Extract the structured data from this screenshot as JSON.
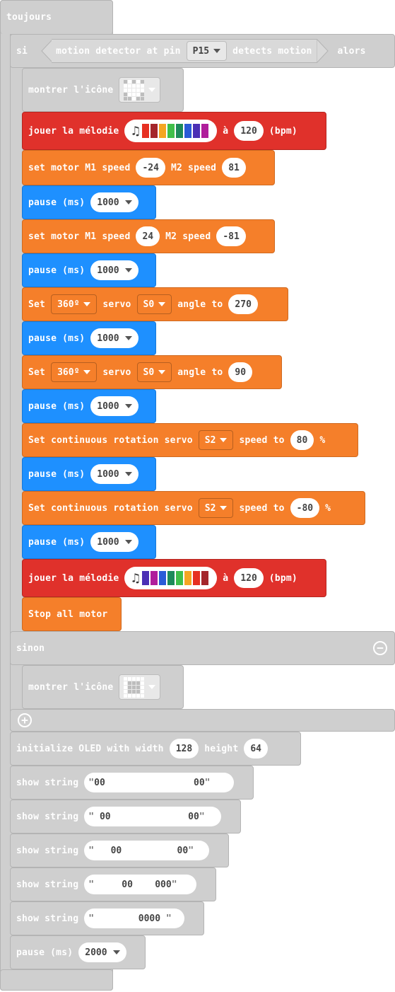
{
  "forever": {
    "label": "toujours"
  },
  "if_block": {
    "if_label": "si",
    "then_label": "alors",
    "condition": {
      "label_prefix": "motion detector at pin",
      "pin": "P15",
      "label_suffix": "detects motion"
    },
    "else_label": "sinon"
  },
  "icons": {
    "minus": "−",
    "plus": "+",
    "note": "♫"
  },
  "colors": {
    "gray": "#cfcfcf",
    "music_red": "#e0312b",
    "motor_orange": "#f57f2a",
    "pause_blue": "#1e90ff"
  },
  "melody_colors": [
    "#e63022",
    "#a4262c",
    "#f5a623",
    "#40bf4a",
    "#1d8a5a",
    "#2a5bd7",
    "#4b2fb5",
    "#b01e9b"
  ],
  "melody_colors_2": [
    "#4b2fb5",
    "#b01e9b",
    "#2a5bd7",
    "#1d8a5a",
    "#40bf4a",
    "#f5a623",
    "#e63022",
    "#a4262c"
  ],
  "blocks": {
    "show_icon_1": {
      "label": "montrer l'icône"
    },
    "play_melody_1": {
      "label": "jouer la mélodie",
      "at": "à",
      "tempo": "120",
      "unit": "(bpm)"
    },
    "motor_1": {
      "label_a": "set motor M1 speed",
      "m1": "-24",
      "label_b": "M2 speed",
      "m2": "81"
    },
    "pause_1": {
      "label": "pause (ms)",
      "value": "1000"
    },
    "motor_2": {
      "label_a": "set motor M1 speed",
      "m1": "24",
      "label_b": "M2 speed",
      "m2": "-81"
    },
    "pause_2": {
      "label": "pause (ms)",
      "value": "1000"
    },
    "servo_1": {
      "set": "Set",
      "type": "360º",
      "servo": "servo",
      "pin": "S0",
      "angle_label": "angle to",
      "angle": "270"
    },
    "pause_3": {
      "label": "pause (ms)",
      "value": "1000"
    },
    "servo_2": {
      "set": "Set",
      "type": "360º",
      "servo": "servo",
      "pin": "S0",
      "angle_label": "angle to",
      "angle": "90"
    },
    "pause_4": {
      "label": "pause (ms)",
      "value": "1000"
    },
    "cont_servo_1": {
      "label": "Set continuous rotation servo",
      "pin": "S2",
      "speed_label": "speed to",
      "speed": "80",
      "unit": "%"
    },
    "pause_5": {
      "label": "pause (ms)",
      "value": "1000"
    },
    "cont_servo_2": {
      "label": "Set continuous rotation servo",
      "pin": "S2",
      "speed_label": "speed to",
      "speed": "-80",
      "unit": "%"
    },
    "pause_6": {
      "label": "pause (ms)",
      "value": "1000"
    },
    "play_melody_2": {
      "label": "jouer la mélodie",
      "at": "à",
      "tempo": "120",
      "unit": "(bpm)"
    },
    "stop_motor": {
      "label": "Stop all motor"
    },
    "show_icon_2": {
      "label": "montrer l'icône"
    },
    "oled_init": {
      "label_a": "initialize OLED with width",
      "width": "128",
      "label_b": "height",
      "height": "64"
    },
    "show_string_1": {
      "label": "show string",
      "value": "00                00"
    },
    "show_string_2": {
      "label": "show string",
      "value": " 00              00"
    },
    "show_string_3": {
      "label": "show string",
      "value": "   00          00"
    },
    "show_string_4": {
      "label": "show string",
      "value": "     00    000"
    },
    "show_string_5": {
      "label": "show string",
      "value": "        0000 "
    },
    "pause_final": {
      "label": "pause (ms)",
      "value": "2000"
    }
  }
}
